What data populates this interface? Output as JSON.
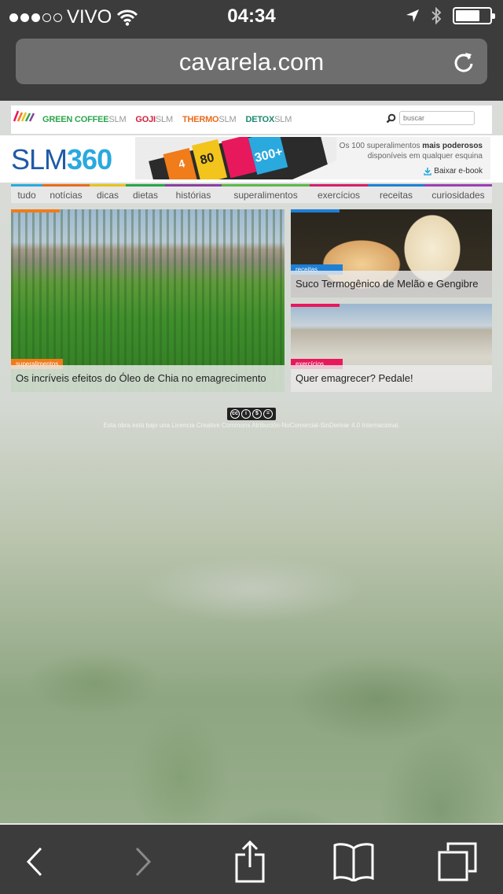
{
  "status_bar": {
    "carrier": "VIVO",
    "time": "04:34",
    "signal_bars_filled": 3,
    "signal_bars_total": 5,
    "battery_level": 0.6,
    "icons": [
      "wifi-icon",
      "location-arrow-icon",
      "bluetooth-icon",
      "battery-icon"
    ]
  },
  "browser": {
    "url": "cavarela.com",
    "reload_icon": "reload-icon"
  },
  "site": {
    "brands": [
      {
        "main": "GREEN COFFEE",
        "suffix": "SLM",
        "color": "#2ba54b"
      },
      {
        "main": "GOJI",
        "suffix": "SLM",
        "color": "#d31f3c"
      },
      {
        "main": "THERMO",
        "suffix": "SLM",
        "color": "#e96c1c"
      },
      {
        "main": "DETOX",
        "suffix": "SLM",
        "color": "#1d8a6f"
      }
    ],
    "search_placeholder": "buscar",
    "logo_light": "SLM",
    "logo_bold": "360",
    "banner": {
      "line1": "Os 100 superalimentos ",
      "line1_bold": "mais poderosos",
      "line2": "disponíveis em qualquer esquina",
      "cta": "Baixar e-book",
      "art_numbers": [
        "4",
        "80",
        "300+"
      ]
    },
    "nav": [
      {
        "label": "tudo",
        "color": "#2aa9df"
      },
      {
        "label": "notícias",
        "color": "#e96c1c"
      },
      {
        "label": "dicas",
        "color": "#e6c31d"
      },
      {
        "label": "dietas",
        "color": "#2ba54b"
      },
      {
        "label": "histórias",
        "color": "#8a3fa0"
      },
      {
        "label": "superalimentos",
        "color": "#5bb84a"
      },
      {
        "label": "exercícios",
        "color": "#d41f6b"
      },
      {
        "label": "receitas",
        "color": "#1e7fd6"
      },
      {
        "label": "curiosidades",
        "color": "#9c3fb2"
      }
    ],
    "cards": [
      {
        "tag": "superalimentos",
        "tag_color": "#f07c1a",
        "title": "Os incríveis efeitos do Óleo de Chia no emagrecimento"
      },
      {
        "tag": "receitas",
        "tag_color": "#1e7fd6",
        "title": "Suco Termogênico de Melão e Gengibre"
      },
      {
        "tag": "exercícios",
        "tag_color": "#e8185c",
        "title": "Quer emagrecer? Pedale!"
      }
    ],
    "license_badge": [
      "cc",
      "i",
      "$",
      "=",
      "BY NC ND"
    ],
    "license_text": "Esta obra está bajo una Licencia Creative Commons Atribución-NoComercial-SinDerivar 4.0 Internacional."
  },
  "toolbar": {
    "buttons": [
      "back-icon",
      "forward-icon",
      "share-icon",
      "bookmarks-icon",
      "tabs-icon"
    ]
  }
}
